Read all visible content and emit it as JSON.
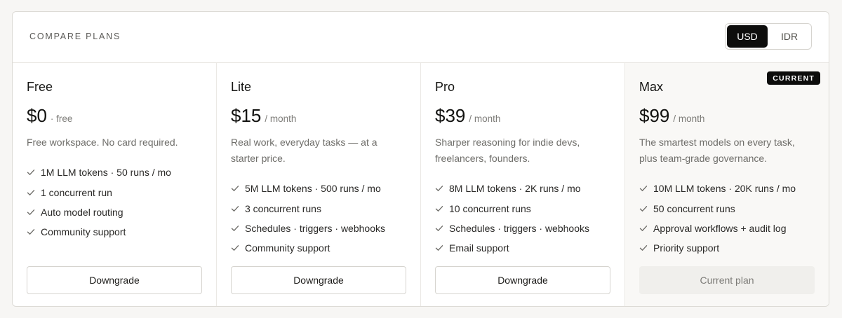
{
  "header": {
    "title": "COMPARE PLANS",
    "currencies": [
      "USD",
      "IDR"
    ],
    "selected_currency": "USD"
  },
  "plans": [
    {
      "name": "Free",
      "price": "$0",
      "period": "· free",
      "description": "Free workspace. No card required.",
      "features": [
        "1M LLM tokens · 50 runs / mo",
        "1 concurrent run",
        "Auto model routing",
        "Community support"
      ],
      "button_label": "Downgrade"
    },
    {
      "name": "Lite",
      "price": "$15",
      "period": "/ month",
      "description": "Real work, everyday tasks — at a starter price.",
      "features": [
        "5M LLM tokens · 500 runs / mo",
        "3 concurrent runs",
        "Schedules · triggers · webhooks",
        "Community support"
      ],
      "button_label": "Downgrade"
    },
    {
      "name": "Pro",
      "price": "$39",
      "period": "/ month",
      "description": "Sharper reasoning for indie devs, freelancers, founders.",
      "features": [
        "8M LLM tokens · 2K runs / mo",
        "10 concurrent runs",
        "Schedules · triggers · webhooks",
        "Email support"
      ],
      "button_label": "Downgrade"
    },
    {
      "name": "Max",
      "price": "$99",
      "period": "/ month",
      "description": "The smartest models on every task, plus team-grade governance.",
      "features": [
        "10M LLM tokens · 20K runs / mo",
        "50 concurrent runs",
        "Approval workflows + audit log",
        "Priority support"
      ],
      "button_label": "Current plan",
      "badge": "CURRENT"
    }
  ],
  "colors": {
    "accent": "#0d0d0c",
    "check": "#6f6e6a",
    "current_bg": "#f9f8f6"
  },
  "icons": {
    "feature": "check-icon"
  }
}
